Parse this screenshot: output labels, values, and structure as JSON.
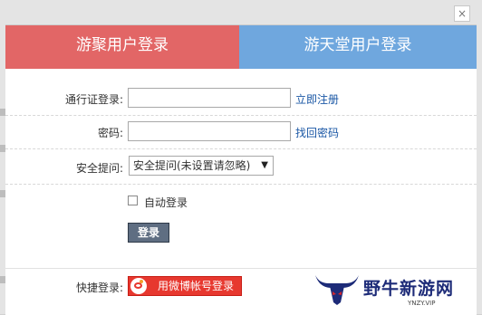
{
  "close": {
    "glyph": "×"
  },
  "tabs": [
    {
      "label": "游聚用户登录"
    },
    {
      "label": "游天堂用户登录"
    }
  ],
  "form": {
    "passport_label": "通行证登录:",
    "passport_value": "",
    "register_link": "立即注册",
    "password_label": "密码:",
    "password_value": "",
    "find_password_link": "找回密码",
    "security_label": "安全提问:",
    "security_selected": "安全提问(未设置请忽略)",
    "auto_login_label": "自动登录",
    "auto_login_checked": false,
    "login_button": "登录",
    "quick_login_label": "快捷登录:",
    "weibo_button": "用微博帐号登录"
  },
  "watermark": {
    "text": "野牛新游网",
    "sub": "YNZY.VIP"
  },
  "colors": {
    "tab_left": "#e26666",
    "tab_right": "#6fa7de",
    "link": "#1a57a5",
    "weibo": "#e7382f"
  },
  "icons": {
    "close": "close-icon",
    "dropdown": "chevron-down-icon",
    "weibo": "weibo-icon",
    "watermark": "bull-logo-icon"
  }
}
